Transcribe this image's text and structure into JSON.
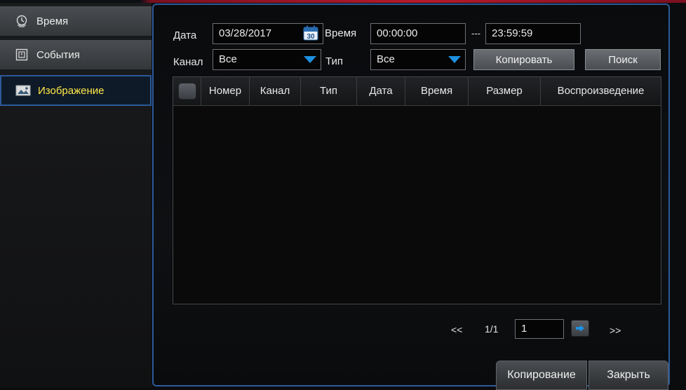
{
  "sidebar": {
    "items": [
      {
        "label": "Время",
        "icon": "clock-icon"
      },
      {
        "label": "События",
        "icon": "event-icon"
      },
      {
        "label": "Изображение",
        "icon": "image-icon",
        "active": true
      }
    ]
  },
  "filters": {
    "date_label": "Дата",
    "date_value": "03/28/2017",
    "calendar_icon_text": "30",
    "time_label": "Время",
    "time_from": "00:00:00",
    "time_separator": "---",
    "time_to": "23:59:59",
    "channel_label": "Канал",
    "channel_value": "Все",
    "type_label": "Тип",
    "type_value": "Все",
    "copy_button": "Копировать",
    "search_button": "Поиск"
  },
  "table": {
    "columns": [
      "Номер",
      "Канал",
      "Тип",
      "Дата",
      "Время",
      "Размер",
      "Воспроизведение"
    ],
    "rows": []
  },
  "pager": {
    "prev": "<<",
    "page_info": "1/1",
    "page_input": "1",
    "next": ">>"
  },
  "footer": {
    "copy_button": "Копирование",
    "close_button": "Закрыть"
  },
  "colors": {
    "accent_blue": "#2c5a9a",
    "active_text": "#ffe84a",
    "top_bar_red": "#b51a2c",
    "arrow_blue": "#1e90e0"
  }
}
